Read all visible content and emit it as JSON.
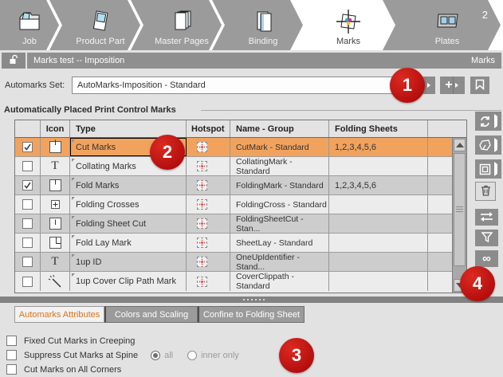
{
  "wizard": {
    "tabs": [
      {
        "label": "Job"
      },
      {
        "label": "Product Part"
      },
      {
        "label": "Master Pages"
      },
      {
        "label": "Binding"
      },
      {
        "label": "Marks",
        "active": true
      },
      {
        "label": "Plates",
        "badge": "2"
      }
    ]
  },
  "title_bar": {
    "title": "Marks test -- Imposition",
    "context": "Marks"
  },
  "automarks": {
    "label": "Automarks Set:",
    "value": "AutoMarks-Imposition - Standard",
    "buttons": [
      {
        "icon": "choose-set-icon"
      },
      {
        "icon": "add-set-icon",
        "glyph": "+"
      },
      {
        "icon": "save-set-icon"
      }
    ]
  },
  "marks_table": {
    "section_title": "Automatically Placed Print Control Marks",
    "headers": {
      "icon": "Icon",
      "type": "Type",
      "hotspot": "Hotspot",
      "name_group": "Name - Group",
      "folding_sheets": "Folding Sheets"
    },
    "rows": [
      {
        "checked": true,
        "icon": "cut-mark-icon",
        "type": "Cut Marks",
        "name_group": "CutMark - Standard",
        "folding_sheets": "1,2,3,4,5,6",
        "selected": true
      },
      {
        "checked": false,
        "icon": "text-mark-icon",
        "type": "Collating Marks",
        "name_group": "CollatingMark - Standard",
        "folding_sheets": ""
      },
      {
        "checked": true,
        "icon": "fold-mark-icon",
        "type": "Fold Marks",
        "name_group": "FoldingMark - Standard",
        "folding_sheets": "1,2,3,4,5,6"
      },
      {
        "checked": false,
        "icon": "folding-cross-icon",
        "type": "Folding Crosses",
        "name_group": "FoldingCross - Standard",
        "folding_sheets": ""
      },
      {
        "checked": false,
        "icon": "sheet-cut-icon",
        "type": "Folding Sheet Cut",
        "name_group": "FoldingSheetCut - Stan...",
        "folding_sheets": ""
      },
      {
        "checked": false,
        "icon": "fold-lay-icon",
        "type": "Fold Lay Mark",
        "name_group": "SheetLay - Standard",
        "folding_sheets": ""
      },
      {
        "checked": false,
        "icon": "text-mark-icon",
        "type": "1up ID",
        "name_group": "OneUpIdentifier - Stand...",
        "folding_sheets": ""
      },
      {
        "checked": false,
        "icon": "clip-path-icon",
        "type": "1up Cover Clip Path Mark",
        "name_group": "CoverClippath - Standard",
        "folding_sheets": ""
      }
    ]
  },
  "side_toolbar": {
    "buttons": [
      "refresh-icon",
      "mark-polygon-icon",
      "frame-icon",
      "trash-icon",
      "swap-arrows-icon",
      "filter-icon",
      "infinity-icon"
    ],
    "infinity_glyph": "∞"
  },
  "bottom_tabs": [
    {
      "label": "Automarks Attributes",
      "active": true
    },
    {
      "label": "Colors and Scaling",
      "active": false
    },
    {
      "label": "Confine to Folding Sheet",
      "active": false
    }
  ],
  "attributes": {
    "checkboxes": [
      {
        "label": "Fixed Cut Marks in Creeping",
        "checked": false
      },
      {
        "label": "Suppress Cut Marks at Spine",
        "checked": false
      },
      {
        "label": "Cut Marks on All Corners",
        "checked": false
      }
    ],
    "spine_radios": [
      {
        "label": "all",
        "selected": true
      },
      {
        "label": "inner only",
        "selected": false
      }
    ]
  },
  "annotations": {
    "step1": "1",
    "step2": "2",
    "step3": "3",
    "step4": "4"
  },
  "colors": {
    "selection_orange": "#f1a35e",
    "annotation_red": "#bf1212",
    "active_tab_text": "#d9731c",
    "chrome_gray": "#9b9b9b"
  }
}
